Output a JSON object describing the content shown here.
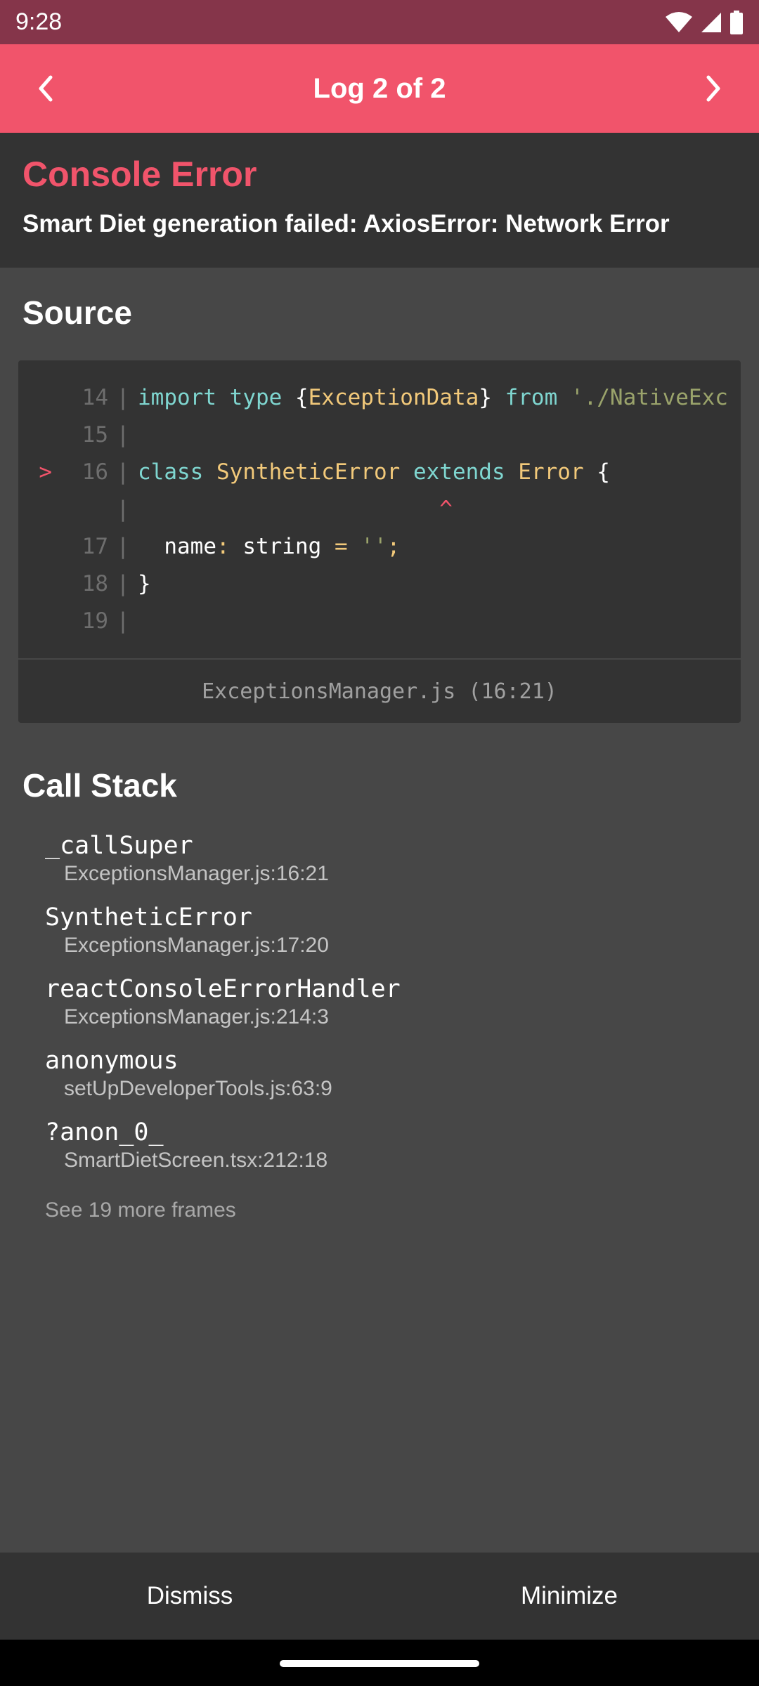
{
  "status_bar": {
    "time": "9:28"
  },
  "header": {
    "title": "Log 2 of 2",
    "prev_icon": "chevron-left-icon",
    "next_icon": "chevron-right-icon"
  },
  "error": {
    "type": "Console Error",
    "message": "Smart Diet generation failed: AxiosError: Network Error"
  },
  "source": {
    "title": "Source",
    "file": "ExceptionsManager.js (16:21)",
    "lines": [
      {
        "marker": "",
        "num": "14",
        "code": "import type {ExceptionData} from './NativeExc"
      },
      {
        "marker": "",
        "num": "15",
        "code": ""
      },
      {
        "marker": ">",
        "num": "16",
        "code": "class SyntheticError extends Error {"
      },
      {
        "marker": "",
        "num": "",
        "code": "                       ^"
      },
      {
        "marker": "",
        "num": "17",
        "code": "  name: string = '';"
      },
      {
        "marker": "",
        "num": "18",
        "code": "}"
      },
      {
        "marker": "",
        "num": "19",
        "code": ""
      }
    ]
  },
  "call_stack": {
    "title": "Call Stack",
    "frames": [
      {
        "name": "_callSuper",
        "location": "ExceptionsManager.js:16:21"
      },
      {
        "name": "SyntheticError",
        "location": "ExceptionsManager.js:17:20"
      },
      {
        "name": "reactConsoleErrorHandler",
        "location": "ExceptionsManager.js:214:3"
      },
      {
        "name": "anonymous",
        "location": "setUpDeveloperTools.js:63:9"
      },
      {
        "name": "?anon_0_",
        "location": "SmartDietScreen.tsx:212:18"
      }
    ],
    "more": "See 19 more frames"
  },
  "footer": {
    "dismiss": "Dismiss",
    "minimize": "Minimize"
  },
  "colors": {
    "accent": "#f1546b",
    "status_bar": "#85354a",
    "panel": "#333333",
    "background": "#474747"
  }
}
